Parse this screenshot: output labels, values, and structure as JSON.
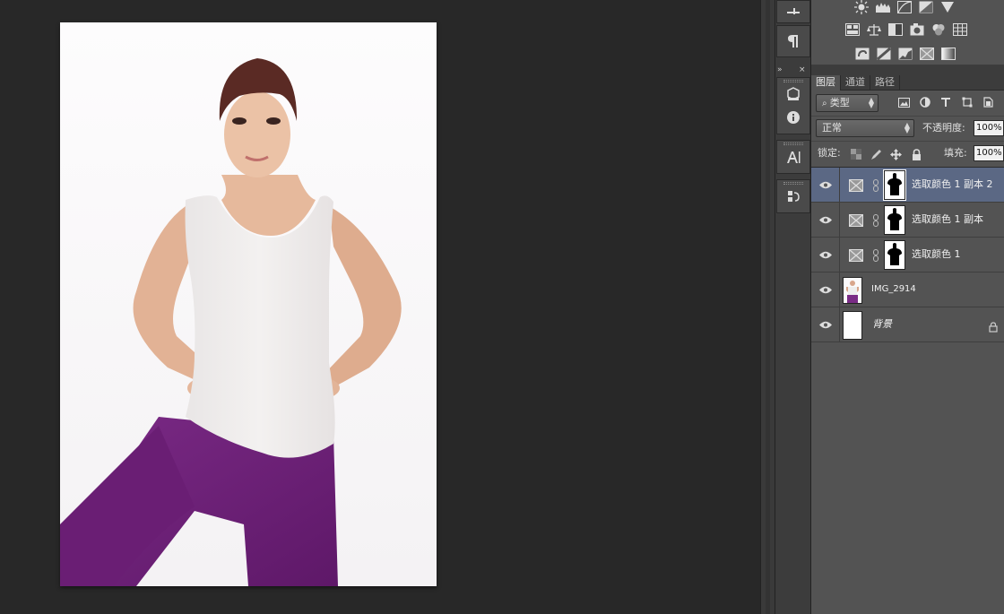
{
  "colors": {
    "canvas_bg": "#282828",
    "panel_bg": "#535353",
    "selected_layer": "#5b6884",
    "shirt": "#f1efee",
    "pants": "#6e1f78",
    "skin": "#e5b79b",
    "hair": "#5a2a24"
  },
  "document": {
    "image_icon": "woman-portrait-photo"
  },
  "tool_column": {
    "groups": [
      {
        "items": [
          {
            "icon": "brush-preset-icon"
          }
        ]
      },
      {
        "items": [
          {
            "icon": "paragraph-icon"
          }
        ]
      },
      {
        "items": [
          {
            "icon": "3d-cube-icon"
          },
          {
            "icon": "info-icon"
          }
        ]
      },
      {
        "items": [
          {
            "icon": "character-icon"
          }
        ]
      },
      {
        "items": [
          {
            "icon": "history-icon"
          }
        ]
      }
    ]
  },
  "adjustments": {
    "row1": [
      "brightness-icon",
      "levels-icon",
      "curves-icon",
      "exposure-icon",
      "vibrance-icon"
    ],
    "row2": [
      "hue-saturation-icon",
      "color-balance-icon",
      "black-white-icon",
      "photo-filter-icon",
      "channel-mixer-icon",
      "color-lookup-icon"
    ],
    "row3": [
      "invert-icon",
      "posterize-icon",
      "threshold-icon",
      "selective-color-icon",
      "gradient-map-icon"
    ]
  },
  "layers_panel": {
    "tabs": [
      {
        "label": "图层",
        "active": true
      },
      {
        "label": "通道",
        "active": false
      },
      {
        "label": "路径",
        "active": false
      }
    ],
    "filter": {
      "label": "类型",
      "icon": "search-icon"
    },
    "blend_mode": "正常",
    "opacity_label": "不透明度:",
    "opacity_value": "100%",
    "lock_label": "锁定:",
    "fill_label": "填充:",
    "fill_value": "100%",
    "layers": [
      {
        "name": "选取颜色 1 副本 2",
        "type": "adjustment",
        "selected": true
      },
      {
        "name": "选取颜色 1 副本",
        "type": "adjustment",
        "selected": false
      },
      {
        "name": "选取颜色 1",
        "type": "adjustment",
        "selected": false
      },
      {
        "name": "IMG_2914",
        "type": "image",
        "selected": false
      },
      {
        "name": "背景",
        "type": "background",
        "selected": false,
        "locked": true
      }
    ]
  }
}
